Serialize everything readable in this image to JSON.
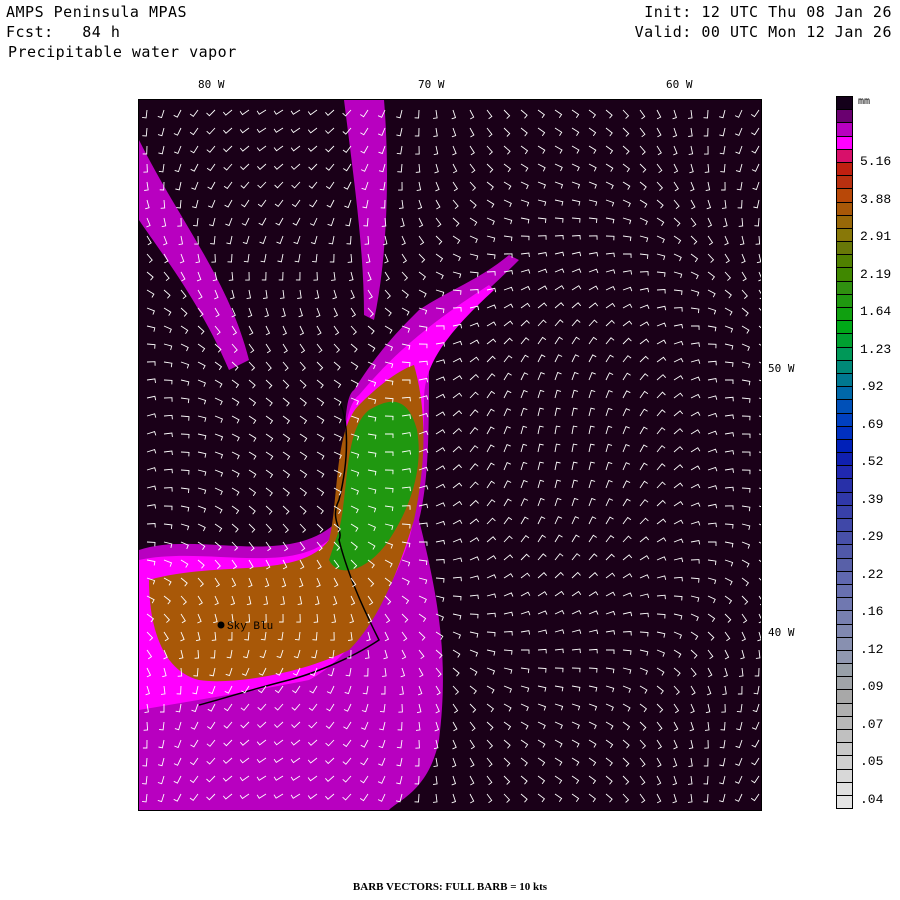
{
  "header": {
    "model": "AMPS Peninsula MPAS",
    "forecast": "Fcst:   84 h",
    "field": "Precipitable water vapor",
    "init": "Init: 12 UTC Thu 08 Jan 26",
    "valid": "Valid: 00 UTC Mon 12 Jan 26"
  },
  "map": {
    "lon_labels": [
      "80 W",
      "70 W",
      "60 W"
    ],
    "lat_labels": [
      "50 W",
      "40 W"
    ],
    "station": "Sky Blu"
  },
  "colorbar": {
    "unit": "mm",
    "labels": [
      "5.16",
      "3.88",
      "2.91",
      "2.19",
      "1.64",
      "1.23",
      ".92",
      ".69",
      ".52",
      ".39",
      ".29",
      ".22",
      ".16",
      ".12",
      ".09",
      ".07",
      ".05",
      ".04"
    ],
    "colors": [
      "#14001a",
      "#6a0070",
      "#b800c0",
      "#ff00ff",
      "#d8106a",
      "#c02010",
      "#b83010",
      "#b84808",
      "#a85808",
      "#986808",
      "#887808",
      "#687808",
      "#508000",
      "#408800",
      "#309010",
      "#209810",
      "#10a010",
      "#00a818",
      "#00a030",
      "#009858",
      "#008878",
      "#007890",
      "#0068a8",
      "#0050b8",
      "#0040c0",
      "#0030c0",
      "#0020b8",
      "#1020b0",
      "#2028b0",
      "#2830a8",
      "#3038a8",
      "#3840a8",
      "#4048a8",
      "#4850a8",
      "#5058a8",
      "#5860a8",
      "#6068b0",
      "#6870b0",
      "#7078b0",
      "#7880b0",
      "#8088b0",
      "#8890b0",
      "#9098b0",
      "#98a0a8",
      "#a0a4a8",
      "#a8a8a8",
      "#b0b0b0",
      "#b8b8b8",
      "#c0c0c0",
      "#c8c8c8",
      "#d0d0d0",
      "#d8d8d8",
      "#e0e0e0",
      "#e4e4e4"
    ]
  },
  "footer": "BARB VECTORS:  FULL BARB = 10 kts"
}
